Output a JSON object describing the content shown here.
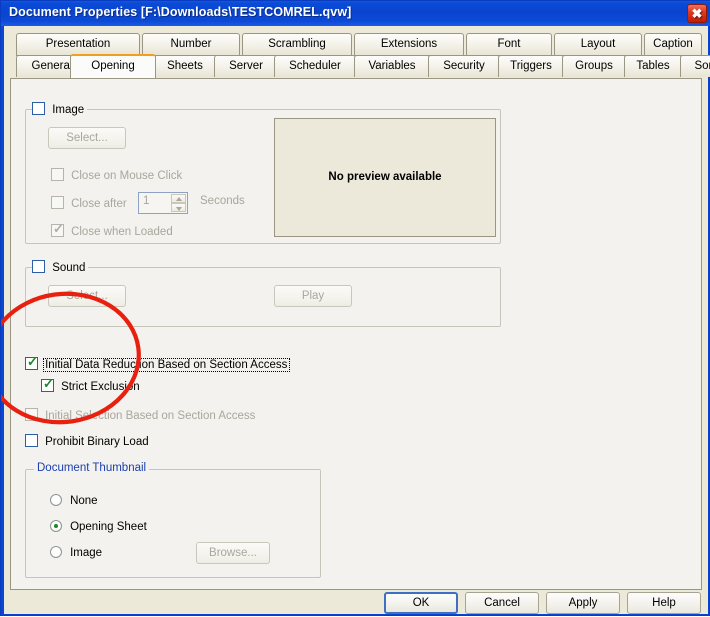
{
  "window": {
    "title": "Document Properties [F:\\Downloads\\TESTCOMREL.qvw]",
    "close_icon": "✖",
    "titlebar_color": "#0a46d2",
    "dialog_bg": "#ece9d8",
    "page_bg": "#f3f2ee"
  },
  "tabs": {
    "row1": [
      {
        "label": "Presentation"
      },
      {
        "label": "Number"
      },
      {
        "label": "Scrambling"
      },
      {
        "label": "Extensions"
      },
      {
        "label": "Font"
      },
      {
        "label": "Layout"
      },
      {
        "label": "Caption"
      }
    ],
    "row2": [
      {
        "label": "General"
      },
      {
        "label": "Opening"
      },
      {
        "label": "Sheets"
      },
      {
        "label": "Server"
      },
      {
        "label": "Scheduler"
      },
      {
        "label": "Variables"
      },
      {
        "label": "Security"
      },
      {
        "label": "Triggers"
      },
      {
        "label": "Groups"
      },
      {
        "label": "Tables"
      },
      {
        "label": "Sort"
      }
    ],
    "active": "Opening",
    "active_accent": "#f0a020"
  },
  "image_group": {
    "legend": "Image",
    "enabled": false,
    "checked": false,
    "select_button": "Select...",
    "close_on_mouse_click": {
      "label": "Close on Mouse Click",
      "checked": false,
      "enabled": false
    },
    "close_after": {
      "label": "Close after",
      "checked": false,
      "enabled": false
    },
    "seconds_value": "1",
    "seconds_label": "Seconds",
    "close_when_loaded": {
      "label": "Close when Loaded",
      "checked": true,
      "enabled": false
    },
    "preview_text": "No preview available"
  },
  "sound_group": {
    "legend": "Sound",
    "checked": false,
    "select_button": "Select...",
    "play_button": "Play"
  },
  "options": [
    {
      "label": "Initial Data Reduction Based on Section Access",
      "checked": true,
      "enabled": true,
      "focused": true
    },
    {
      "label": "Strict Exclusion",
      "checked": true,
      "enabled": true,
      "focused": false
    },
    {
      "label": "Initial Selection Based on Section Access",
      "checked": false,
      "enabled": false,
      "focused": false
    },
    {
      "label": "Prohibit Binary Load",
      "checked": false,
      "enabled": true,
      "focused": false
    }
  ],
  "thumbnail_group": {
    "legend": "Document Thumbnail",
    "options": [
      {
        "label": "None",
        "selected": false
      },
      {
        "label": "Opening Sheet",
        "selected": true
      },
      {
        "label": "Image",
        "selected": false
      }
    ],
    "browse_button": "Browse..."
  },
  "dialog_buttons": [
    {
      "label": "OK",
      "default": true
    },
    {
      "label": "Cancel",
      "default": false
    },
    {
      "label": "Apply",
      "default": false
    },
    {
      "label": "Help",
      "default": false
    }
  ],
  "annotation": {
    "shape": "ellipse",
    "color": "#e82010"
  }
}
